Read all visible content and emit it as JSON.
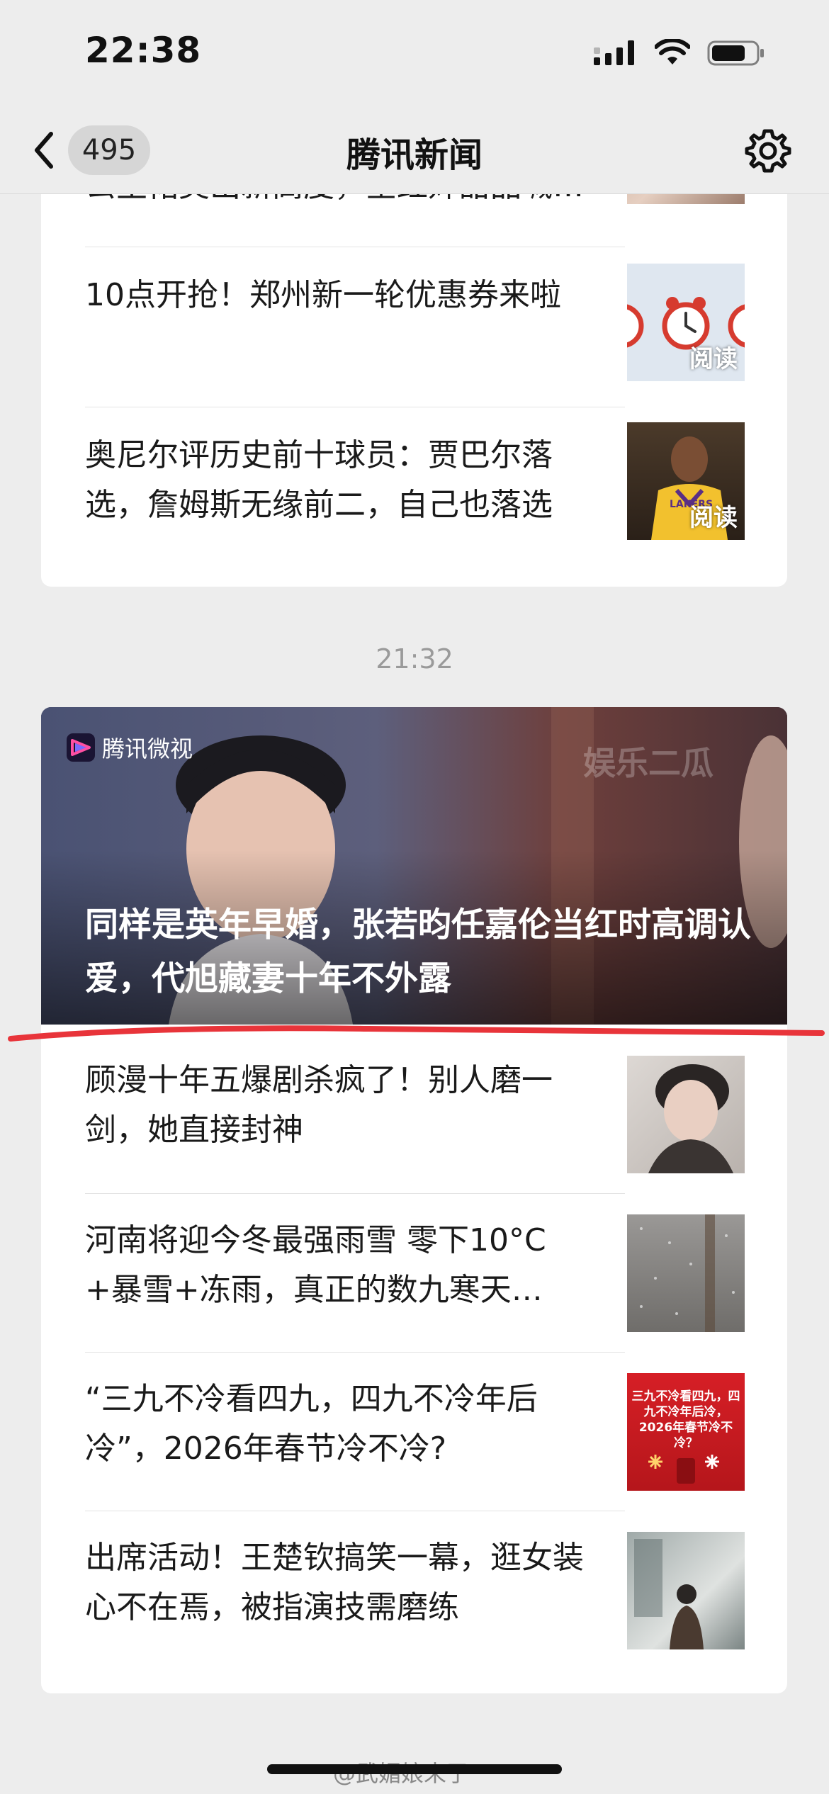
{
  "status_bar": {
    "time": "22:38"
  },
  "nav": {
    "back_count": "495",
    "title": "腾讯新闻"
  },
  "card_top": {
    "items": [
      {
        "title": "公主裙美出新高度，全红婵甜品喊…"
      },
      {
        "title": "10点开抢！郑州新一轮优惠券来啦",
        "thumb_label": "阅读"
      },
      {
        "title": "奥尼尔评历史前十球员：贾巴尔落选，詹姆斯无缘前二，自己也落选",
        "thumb_label": "阅读"
      }
    ]
  },
  "timestamp": "21:32",
  "card_bottom": {
    "hero": {
      "brand": "腾讯微视",
      "watermark": "娱乐二瓜",
      "title": "同样是英年早婚，张若昀任嘉伦当红时高调认爱，代旭藏妻十年不外露"
    },
    "items": [
      {
        "title": "顾漫十年五爆剧杀疯了！别人磨一剑，她直接封神"
      },
      {
        "title": "河南将迎今冬最强雨雪 零下10°C +暴雪+冻雨，真正的数九寒天…"
      },
      {
        "title": "“三九不冷看四九，四九不冷年后冷”，2026年春节冷不冷?",
        "thumb_text": "三九不冷看四九，四九不冷年后冷，2026年春节冷不冷？"
      },
      {
        "title": "出席活动！王楚钦搞笑一幕，逛女装心不在焉，被指演技需磨练"
      }
    ]
  },
  "watermark": "@武媚娘来了",
  "colors": {
    "annotation_line": "#e8343a",
    "background": "#ededed"
  }
}
